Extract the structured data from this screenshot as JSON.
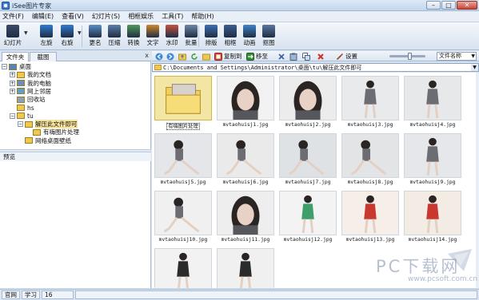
{
  "app": {
    "title": "iSee图片专家"
  },
  "window_buttons": {
    "minimize": "–",
    "maximize": "□",
    "close": "✕"
  },
  "menu": [
    "文件(F)",
    "编辑(E)",
    "查看(V)",
    "幻灯片(S)",
    "相框娱乐",
    "工具(T)",
    "帮助(H)"
  ],
  "toolbar": [
    {
      "label": "幻灯片",
      "icon": "slideshow-icon",
      "color": "#3a4b66"
    },
    {
      "label": "左旋",
      "icon": "rotate-left-icon",
      "color": "#2f7dd2"
    },
    {
      "label": "右旋",
      "icon": "rotate-right-icon",
      "color": "#2f7dd2"
    },
    {
      "label": "更名",
      "icon": "rename-icon",
      "color": "#5a8fc9"
    },
    {
      "label": "压缩",
      "icon": "compress-icon",
      "color": "#5b7fa8"
    },
    {
      "label": "转换",
      "icon": "convert-icon",
      "color": "#4d9a5a"
    },
    {
      "label": "文字",
      "icon": "text-icon",
      "color": "#d08a2a"
    },
    {
      "label": "水印",
      "icon": "watermark-icon",
      "color": "#c9523f"
    },
    {
      "label": "批量",
      "icon": "batch-icon",
      "color": "#6f88a7"
    },
    {
      "label": "排版",
      "icon": "layout-icon",
      "color": "#3d6fb0"
    },
    {
      "label": "相框",
      "icon": "frame-icon",
      "color": "#3b5e91"
    },
    {
      "label": "动画",
      "icon": "animation-icon",
      "color": "#3f86c9"
    },
    {
      "label": "抠图",
      "icon": "cutout-icon",
      "color": "#5878a0"
    }
  ],
  "left_tabs": {
    "files": "文件夹",
    "capture": "截图",
    "close": "x"
  },
  "tree": [
    {
      "label": "桌面",
      "level": 0,
      "expander": "−",
      "type": "desktop"
    },
    {
      "label": "我的文档",
      "level": 1,
      "expander": "+",
      "type": "folder"
    },
    {
      "label": "我的电脑",
      "level": 1,
      "expander": "+",
      "type": "computer"
    },
    {
      "label": "网上邻居",
      "level": 1,
      "expander": "+",
      "type": "network"
    },
    {
      "label": "回收站",
      "level": 1,
      "expander": "",
      "type": "recycle"
    },
    {
      "label": "hs",
      "level": 1,
      "expander": "",
      "type": "folder"
    },
    {
      "label": "tu",
      "level": 1,
      "expander": "−",
      "type": "folder"
    },
    {
      "label": "解压此文件即可",
      "level": 2,
      "expander": "−",
      "type": "folder",
      "selected": true
    },
    {
      "label": "有嗨图片处理",
      "level": 3,
      "expander": "",
      "type": "folder"
    },
    {
      "label": "网络桌面壁纸",
      "level": 2,
      "expander": "",
      "type": "folder"
    }
  ],
  "preview": {
    "label": "预览"
  },
  "nav": {
    "copy_to": "复制到",
    "move_to": "移至",
    "settings": "设置",
    "sort": "文件名称"
  },
  "zoom_level": 0.58,
  "path": "C:\\Documents and Settings\\Administrator\\桌面\\tu\\解压此文件即可",
  "files": [
    {
      "name": "有嗨图片处理",
      "kind": "folder",
      "selected": true
    },
    {
      "name": "mvtaohuisj1.jpg",
      "kind": "photo",
      "bg": "#f2f2f2",
      "pose": "portrait"
    },
    {
      "name": "mvtaohuisj2.jpg",
      "kind": "photo",
      "bg": "#ececec",
      "pose": "portrait"
    },
    {
      "name": "mvtaohuisj3.jpg",
      "kind": "photo",
      "bg": "#e9eaec",
      "pose": "standing"
    },
    {
      "name": "mvtaohuisj4.jpg",
      "kind": "photo",
      "bg": "#e6e8ea",
      "pose": "standing"
    },
    {
      "name": "mvtaohuisj5.jpg",
      "kind": "photo",
      "bg": "#e4e6e9",
      "pose": "sitting"
    },
    {
      "name": "mvtaohuisj6.jpg",
      "kind": "photo",
      "bg": "#eaeaea",
      "pose": "sitting"
    },
    {
      "name": "mvtaohuisj7.jpg",
      "kind": "photo",
      "bg": "#dfe2e5",
      "pose": "sitting"
    },
    {
      "name": "mvtaohuisj8.jpg",
      "kind": "photo",
      "bg": "#e3e4e6",
      "pose": "sitting"
    },
    {
      "name": "mvtaohuisj9.jpg",
      "kind": "photo",
      "bg": "#e5e7ea",
      "pose": "standing"
    },
    {
      "name": "mvtaohuisj10.jpg",
      "kind": "photo",
      "bg": "#f0f0f0",
      "pose": "sitting"
    },
    {
      "name": "mvtaohuisj11.jpg",
      "kind": "photo",
      "bg": "#eeeeee",
      "pose": "portrait"
    },
    {
      "name": "mvtaohuisj12.jpg",
      "kind": "photo",
      "bg": "#f3f3f3",
      "pose": "standing-green"
    },
    {
      "name": "mvtaohuisj13.jpg",
      "kind": "photo",
      "bg": "#f6eee8",
      "pose": "standing-red"
    },
    {
      "name": "mvtaohuisj14.jpg",
      "kind": "photo",
      "bg": "#f3ece5",
      "pose": "standing-red"
    },
    {
      "name": "",
      "kind": "photo",
      "bg": "#f2f2f2",
      "pose": "standing-dark"
    },
    {
      "name": "",
      "kind": "photo",
      "bg": "#f0f0f0",
      "pose": "standing-dark"
    }
  ],
  "status": {
    "a": "官网",
    "b": "学习",
    "count": "16"
  },
  "watermark": {
    "brand": "PC下载网",
    "url": "www.pcsoft.com.cn"
  }
}
